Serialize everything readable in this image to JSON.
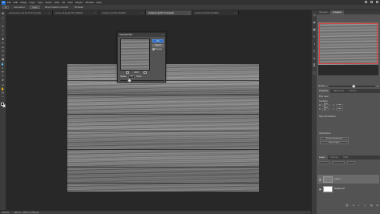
{
  "menubar": {
    "logo": "Ps",
    "items": [
      "File",
      "Edit",
      "Image",
      "Layer",
      "Type",
      "Select",
      "Filter",
      "3D",
      "View",
      "Plugins",
      "Window",
      "Help"
    ]
  },
  "options": {
    "items": [
      "Auto-Select:",
      "Layer",
      "Show Transform Controls",
      "3D Mode:"
    ]
  },
  "tabs": [
    {
      "label": "wood-texture.psd @ 33.3% (Gray/8)",
      "active": false
    },
    {
      "label": "texture-02.jpg @ 25% (RGB/8)",
      "active": false
    },
    {
      "label": "Untitled-1 @ 50% (RGB/8)",
      "active": false
    },
    {
      "label": "Untitled-2 @ 66.7% (Gray/8)",
      "active": true
    },
    {
      "label": "Untitled-3 @ 50% (RGB/8)",
      "active": false
    }
  ],
  "tools": [
    "move-icon",
    "marquee-icon",
    "lasso-icon",
    "quick-select-icon",
    "crop-icon",
    "eyedropper-icon",
    "healing-icon",
    "brush-icon",
    "clone-stamp-icon",
    "history-brush-icon",
    "eraser-icon",
    "gradient-icon",
    "blur-icon",
    "dodge-icon",
    "pen-icon",
    "type-icon",
    "path-select-icon",
    "rectangle-icon",
    "hand-icon",
    "zoom-icon",
    "more-tools-icon"
  ],
  "tool_glyphs": [
    "✥",
    "⬚",
    "◌",
    "✎",
    "⌗",
    "⁄",
    "✚",
    "✏",
    "⎈",
    "↺",
    "◇",
    "▤",
    "💧",
    "◐",
    "✒",
    "T",
    "➤",
    "▭",
    "✋",
    "⚲",
    "⋯"
  ],
  "dialog": {
    "title": "Gaussian Blur",
    "close": "×",
    "ok": "OK",
    "cancel": "Cancel",
    "preview_label": "Preview",
    "zoom_pct": "100%",
    "radius_label": "Radius:",
    "radius_value": "1.0",
    "radius_unit": "Pixels",
    "radius_fraction": 0.2
  },
  "status": {
    "zoom": "66.67%",
    "info": "4000 px x 2667 px (300 ppi)"
  },
  "panel_icons": [
    "history-icon",
    "color-icon",
    "swatches-icon",
    "brush-settings-icon",
    "adjustments-icon",
    "paragraph-icon",
    "character-icon",
    "properties-icon",
    "info-icon"
  ],
  "panel_icon_glyphs": [
    "◷",
    "◉",
    "▦",
    "✎",
    "◑",
    "¶",
    "A",
    "≣",
    "ⓘ"
  ],
  "navigator": {
    "tabs": [
      "Histogram",
      "Navigator"
    ],
    "zoom": "66.67%"
  },
  "properties": {
    "tabs": [
      "Properties",
      "Adjustments",
      "Libraries"
    ],
    "header": "Pixel Layer",
    "transform_label": "Transform",
    "w": "W",
    "h": "H",
    "x": "X",
    "y": "Y",
    "w_val": "4000 px",
    "h_val": "2667 px",
    "x_val": "0 px",
    "y_val": "0 px",
    "align_label": "Align and Distribute",
    "quick_label": "Quick Actions",
    "remove_bg": "Remove Background",
    "select_subject": "Select Subject"
  },
  "layers": {
    "tabs": [
      "Layers",
      "Channels",
      "Paths"
    ],
    "rows": [
      {
        "name": "Layer 1",
        "selected": true,
        "thumb": "#7e7e7e"
      },
      {
        "name": "Background",
        "selected": false,
        "thumb": "#ffffff"
      }
    ],
    "tool_glyphs": [
      "⛓",
      "fx",
      "◐",
      "▢",
      "▤",
      "⊞",
      "🗑"
    ]
  }
}
